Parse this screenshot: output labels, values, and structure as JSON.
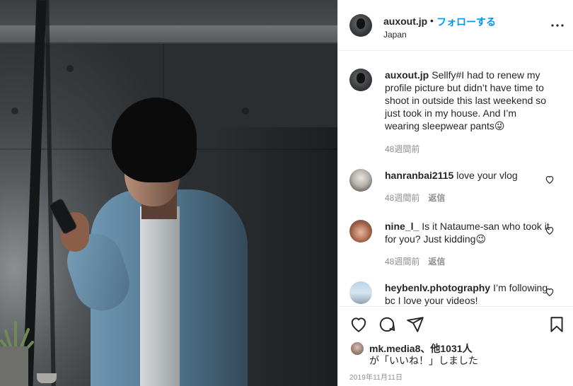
{
  "post": {
    "username": "auxout.jp",
    "separator": "•",
    "follow_label": "フォローする",
    "location": "Japan",
    "more_icon": "more-icon"
  },
  "comments": [
    {
      "username": "auxout.jp",
      "text": "Sellfy#I had to renew my profile picture but didn’t have time to shoot in outside this last weekend so just took in my house. And I’m wearing sleepwear pants😜",
      "time": "48週間前",
      "reply": ""
    },
    {
      "username": "hanranbai2115",
      "text": "love your vlog",
      "time": "48週間前",
      "reply": "返信"
    },
    {
      "username": "nine_l_",
      "text": "Is it Nataume-san who took it for you? Just kidding😉",
      "time": "48週間前",
      "reply": "返信"
    },
    {
      "username": "heybenlv.photography",
      "text": "I’m following bc I love your videos!",
      "time": "",
      "reply": ""
    }
  ],
  "likes": {
    "users": "mk.media8、他1031人",
    "suffix": "が「いいね！」しました"
  },
  "date": "2019年11月11日",
  "colors": {
    "accent": "#0095f6",
    "text": "#262626",
    "muted": "#8e8e8e",
    "divider": "#efefef"
  }
}
